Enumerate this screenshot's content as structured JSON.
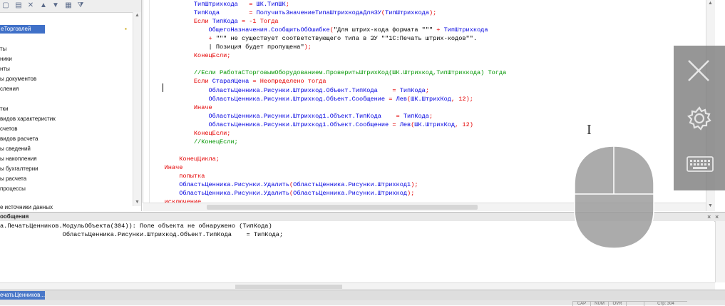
{
  "left_panel": {
    "selected_item": "еТорговлей",
    "items": [
      "ты",
      "ники",
      "нты",
      "ы документов",
      "сления",
      "",
      "тки",
      "видов характеристик",
      "счетов",
      "видов расчета",
      "ы сведений",
      "ы накопления",
      "ы бухгалтерии",
      "ы расчета",
      "процессы",
      "",
      "е источники данных"
    ]
  },
  "code": {
    "lines": [
      [
        {
          "t": "            ",
          "c": "st"
        },
        {
          "t": "ТипШтрихкода",
          "c": "id"
        },
        {
          "t": "   = ",
          "c": "kw"
        },
        {
          "t": "ШК.ТипШК",
          "c": "id"
        },
        {
          "t": ";",
          "c": "kw"
        }
      ],
      [
        {
          "t": "            ",
          "c": "st"
        },
        {
          "t": "ТипКода",
          "c": "id"
        },
        {
          "t": "        = ",
          "c": "kw"
        },
        {
          "t": "ПолучитьЗначениеТипаШтрихкодаДляЗУ",
          "c": "id"
        },
        {
          "t": "(",
          "c": "kw"
        },
        {
          "t": "ТипШтрихкода",
          "c": "id"
        },
        {
          "t": ");",
          "c": "kw"
        }
      ],
      [
        {
          "t": "            ",
          "c": "st"
        },
        {
          "t": "Если ",
          "c": "kw"
        },
        {
          "t": "ТипКода",
          "c": "id"
        },
        {
          "t": " = -1 ",
          "c": "kw"
        },
        {
          "t": "Тогда",
          "c": "kw"
        }
      ],
      [
        {
          "t": "                ",
          "c": "st"
        },
        {
          "t": "ОбщегоНазначения.СообщитьОбОшибке",
          "c": "id"
        },
        {
          "t": "(",
          "c": "kw"
        },
        {
          "t": "\"Для штрих-кода формата \"\"\"",
          "c": "st"
        },
        {
          "t": " + ",
          "c": "kw"
        },
        {
          "t": "ТипШтрихкода",
          "c": "id"
        }
      ],
      [
        {
          "t": "                ",
          "c": "st"
        },
        {
          "t": "+ ",
          "c": "kw"
        },
        {
          "t": "\"\"\" не существует соответствующего типа в ЗУ \"\"1С:Печать штрих-кодов\"\".",
          "c": "st"
        }
      ],
      [
        {
          "t": "                ",
          "c": "st"
        },
        {
          "t": "| Позиция будет пропущена\"",
          "c": "st"
        },
        {
          "t": ");",
          "c": "kw"
        }
      ],
      [
        {
          "t": "            ",
          "c": "st"
        },
        {
          "t": "КонецЕсли;",
          "c": "kw"
        }
      ],
      [
        {
          "t": "",
          "c": "st"
        }
      ],
      [
        {
          "t": "            ",
          "c": "st"
        },
        {
          "t": "//Если РаботаСТорговымОборудованием.ПроверитьШтрихКод(ШК.Штрихкод,ТипШтрихкода) Тогда",
          "c": "cm"
        }
      ],
      [
        {
          "t": "            ",
          "c": "st"
        },
        {
          "t": "Если ",
          "c": "kw"
        },
        {
          "t": "СтараяЦена",
          "c": "id"
        },
        {
          "t": " = ",
          "c": "kw"
        },
        {
          "t": "Неопределено ",
          "c": "kw"
        },
        {
          "t": "тогда",
          "c": "kw"
        }
      ],
      [
        {
          "t": "                ",
          "c": "st"
        },
        {
          "t": "ОбластьЦенника.Рисунки.Штрихкод.Объект.ТипКода",
          "c": "id"
        },
        {
          "t": "    = ",
          "c": "kw"
        },
        {
          "t": "ТипКода",
          "c": "id"
        },
        {
          "t": ";",
          "c": "kw"
        }
      ],
      [
        {
          "t": "                ",
          "c": "st"
        },
        {
          "t": "ОбластьЦенника.Рисунки.Штрихкод.Объект.Сообщение",
          "c": "id"
        },
        {
          "t": " = ",
          "c": "kw"
        },
        {
          "t": "Лев",
          "c": "id"
        },
        {
          "t": "(",
          "c": "kw"
        },
        {
          "t": "ШК.ШтрихКод",
          "c": "id"
        },
        {
          "t": ", 12);",
          "c": "kw"
        }
      ],
      [
        {
          "t": "            ",
          "c": "st"
        },
        {
          "t": "Иначе",
          "c": "kw"
        }
      ],
      [
        {
          "t": "                ",
          "c": "st"
        },
        {
          "t": "ОбластьЦенника.Рисунки.Штрихкод1.Объект.ТипКода",
          "c": "id"
        },
        {
          "t": "    = ",
          "c": "kw"
        },
        {
          "t": "ТипКода",
          "c": "id"
        },
        {
          "t": ";",
          "c": "kw"
        }
      ],
      [
        {
          "t": "                ",
          "c": "st"
        },
        {
          "t": "ОбластьЦенника.Рисунки.Штрихкод1.Объект.Сообщение",
          "c": "id"
        },
        {
          "t": " = ",
          "c": "kw"
        },
        {
          "t": "Лев",
          "c": "id"
        },
        {
          "t": "(",
          "c": "kw"
        },
        {
          "t": "ШК.ШтрихКод",
          "c": "id"
        },
        {
          "t": ", 12)",
          "c": "kw"
        }
      ],
      [
        {
          "t": "            ",
          "c": "st"
        },
        {
          "t": "КонецЕсли;",
          "c": "kw"
        }
      ],
      [
        {
          "t": "            ",
          "c": "st"
        },
        {
          "t": "//КонецЕсли;",
          "c": "cm"
        }
      ],
      [
        {
          "t": "",
          "c": "st"
        }
      ],
      [
        {
          "t": "        ",
          "c": "st"
        },
        {
          "t": "КонецЦикла;",
          "c": "kw"
        }
      ],
      [
        {
          "t": "    ",
          "c": "st"
        },
        {
          "t": "Иначе",
          "c": "kw"
        }
      ],
      [
        {
          "t": "        ",
          "c": "st"
        },
        {
          "t": "попытка",
          "c": "kw"
        }
      ],
      [
        {
          "t": "        ",
          "c": "st"
        },
        {
          "t": "ОбластьЦенника.Рисунки.Удалить",
          "c": "id"
        },
        {
          "t": "(",
          "c": "kw"
        },
        {
          "t": "ОбластьЦенника.Рисунки.Штрихкод1",
          "c": "id"
        },
        {
          "t": ");",
          "c": "kw"
        }
      ],
      [
        {
          "t": "        ",
          "c": "st"
        },
        {
          "t": "ОбластьЦенника.Рисунки.Удалить",
          "c": "id"
        },
        {
          "t": "(",
          "c": "kw"
        },
        {
          "t": "ОбластьЦенника.Рисунки.Штрихкод",
          "c": "id"
        },
        {
          "t": ");",
          "c": "kw"
        }
      ],
      [
        {
          "t": "    ",
          "c": "st"
        },
        {
          "t": "исключение",
          "c": "kw"
        }
      ]
    ]
  },
  "messages": {
    "title": "ообщения",
    "close_glyph": "×",
    "pin_glyph": "×",
    "lines": [
      "а.ПечатьЦенников.МодульОбъекта(304)): Поле объекта не обнаружено (ТипКода)",
      "                 ОбластьЦенника.Рисунки.Штрихкод.Объект.ТипКода    = ТипКода;"
    ]
  },
  "window_tabs": {
    "active": "ечатьЦенников..."
  },
  "status_bar": {
    "cells": [
      "CAP",
      "NUM",
      "OVR",
      "",
      "Стр: 304"
    ]
  },
  "overlay": {
    "close_icon": "close-icon",
    "settings_icon": "gear-icon",
    "keyboard_icon": "keyboard-icon"
  },
  "colors": {
    "keyword": "#e40000",
    "identifier": "#0000e0",
    "comment": "#009500",
    "selection": "#3f70c8"
  }
}
